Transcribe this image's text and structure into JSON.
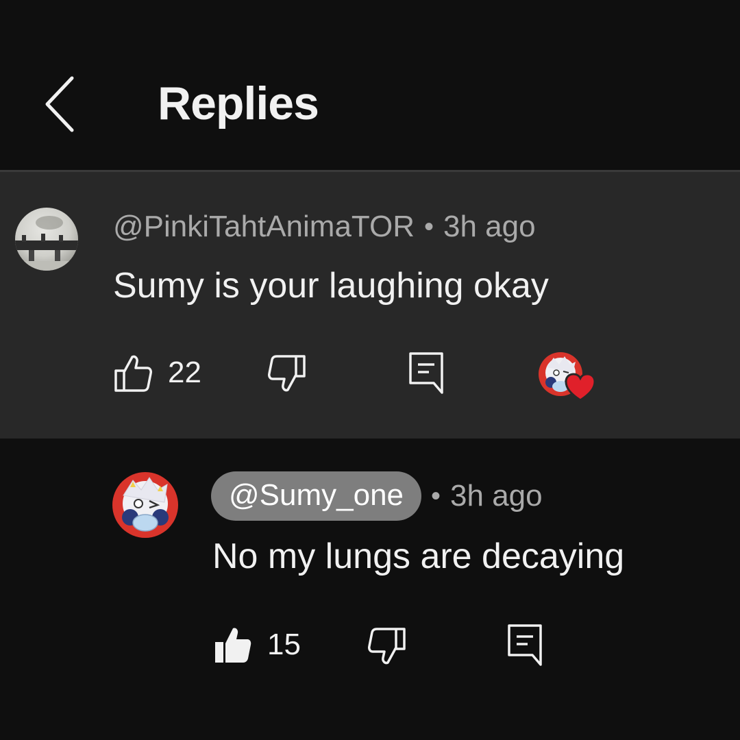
{
  "header": {
    "title": "Replies",
    "back_icon": "chevron-left-icon"
  },
  "parent_comment": {
    "author": "@PinkiTahtAnimaTOR",
    "separator": "•",
    "time": "3h ago",
    "text": "Sumy is your laughing okay",
    "like_count": "22",
    "creator_heart": true
  },
  "reply_comment": {
    "author": "@Sumy_one",
    "separator": "•",
    "time": "3h ago",
    "text": "No my lungs are decaying",
    "like_count": "15",
    "liked": true
  },
  "colors": {
    "background": "#0f0f0f",
    "highlight_background": "#282828",
    "secondary_text": "#aaaaaa",
    "heart": "#e0202a",
    "author_pill": "#7e7e7e"
  }
}
